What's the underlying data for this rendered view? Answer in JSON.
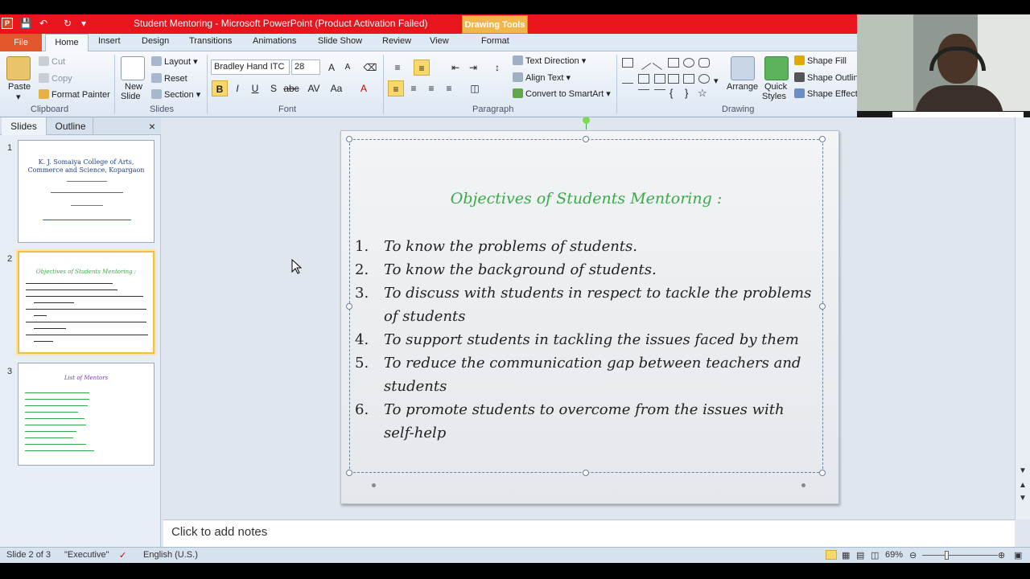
{
  "window": {
    "title": "Student Mentoring  -  Microsoft PowerPoint (Product Activation Failed)",
    "context_tab": "Drawing Tools"
  },
  "tabs": [
    "File",
    "Home",
    "Insert",
    "Design",
    "Transitions",
    "Animations",
    "Slide Show",
    "Review",
    "View",
    "Format"
  ],
  "ribbon": {
    "clipboard": {
      "paste": "Paste",
      "cut": "Cut",
      "copy": "Copy",
      "format_painter": "Format Painter",
      "label": "Clipboard"
    },
    "slides": {
      "new_slide": "New",
      "new_slide2": "Slide",
      "layout": "Layout",
      "reset": "Reset",
      "section": "Section",
      "label": "Slides"
    },
    "font": {
      "name": "Bradley Hand ITC",
      "size": "28",
      "label": "Font"
    },
    "paragraph": {
      "text_direction": "Text Direction",
      "align_text": "Align Text",
      "convert_smartart": "Convert to SmartArt",
      "label": "Paragraph"
    },
    "drawing": {
      "arrange": "Arrange",
      "quick_styles": "Quick",
      "quick_styles2": "Styles",
      "shape_fill": "Shape Fill",
      "shape_outline": "Shape Outline",
      "shape_effects": "Shape Effects",
      "label": "Drawing"
    }
  },
  "slides_panel": {
    "tab_slides": "Slides",
    "tab_outline": "Outline",
    "thumbs": [
      {
        "num": "1",
        "lines": [
          "K. J. Somaiya College of Arts,",
          "Commerce and Science, Kopargaon"
        ]
      },
      {
        "num": "2",
        "lines": [
          "Objectives of Students Mentoring :"
        ]
      },
      {
        "num": "3",
        "lines": [
          "List of Mentors"
        ]
      }
    ]
  },
  "slide": {
    "title": "Objectives of Students Mentoring :",
    "objectives": [
      {
        "n": "1.",
        "text": "To know the problems of students."
      },
      {
        "n": "2.",
        "text": "To know the background of students."
      },
      {
        "n": "3.",
        "text": "To discuss with students in respect to tackle the problems of students"
      },
      {
        "n": "4.",
        "text": "To support students in tackling the issues faced by them"
      },
      {
        "n": "5.",
        "text": "To reduce the communication gap between teachers and students"
      },
      {
        "n": "6.",
        "text": "To promote students to overcome from the issues with self-help"
      }
    ]
  },
  "notes": {
    "placeholder": "Click to add notes"
  },
  "status": {
    "slide_info": "Slide 2 of 3",
    "theme": "\"Executive\"",
    "language": "English (U.S.)",
    "zoom": "69%"
  },
  "colors": {
    "title_bar": "#e8141e",
    "drawing_tools": "#f0b64a",
    "file_tab": "#e2572b",
    "slide_title": "#3aaa48"
  }
}
